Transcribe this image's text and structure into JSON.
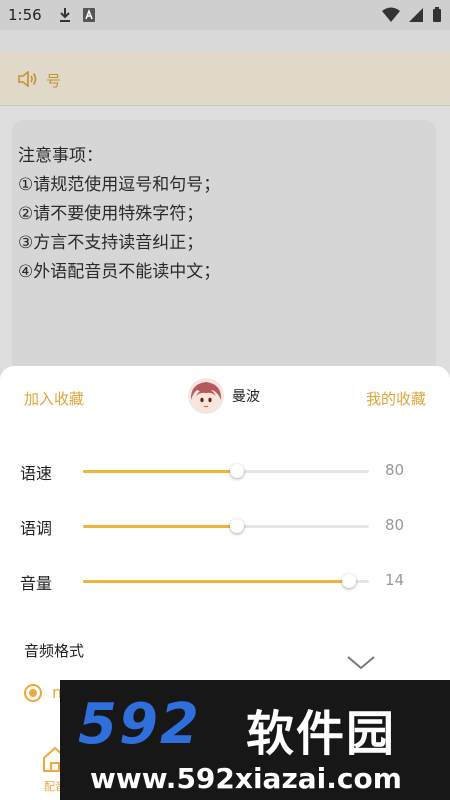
{
  "status_bar": {
    "time": "1:56"
  },
  "voice_bar": {
    "label": "号"
  },
  "notes": {
    "lines": [
      "注意事项：",
      "①请规范使用逗号和句号；",
      "②请不要使用特殊字符；",
      "③方言不支持读音纠正；",
      "④外语配音员不能读中文；"
    ]
  },
  "sheet": {
    "add_favorite_label": "加入收藏",
    "my_favorites_label": "我的收藏",
    "voice_name": "曼波",
    "sliders": [
      {
        "label": "语速",
        "value": "80",
        "position": 0.54
      },
      {
        "label": "语调",
        "value": "80",
        "position": 0.54
      },
      {
        "label": "音量",
        "value": "14",
        "position": 0.93
      }
    ],
    "format_title": "音频格式",
    "format_option": "m",
    "tab_label": "配音"
  },
  "watermark": {
    "logo": "592",
    "logo_text": "软件园",
    "url": "www.592xiazai.com"
  },
  "colors": {
    "accent": "#f0b43c",
    "link": "#e1a53a"
  }
}
